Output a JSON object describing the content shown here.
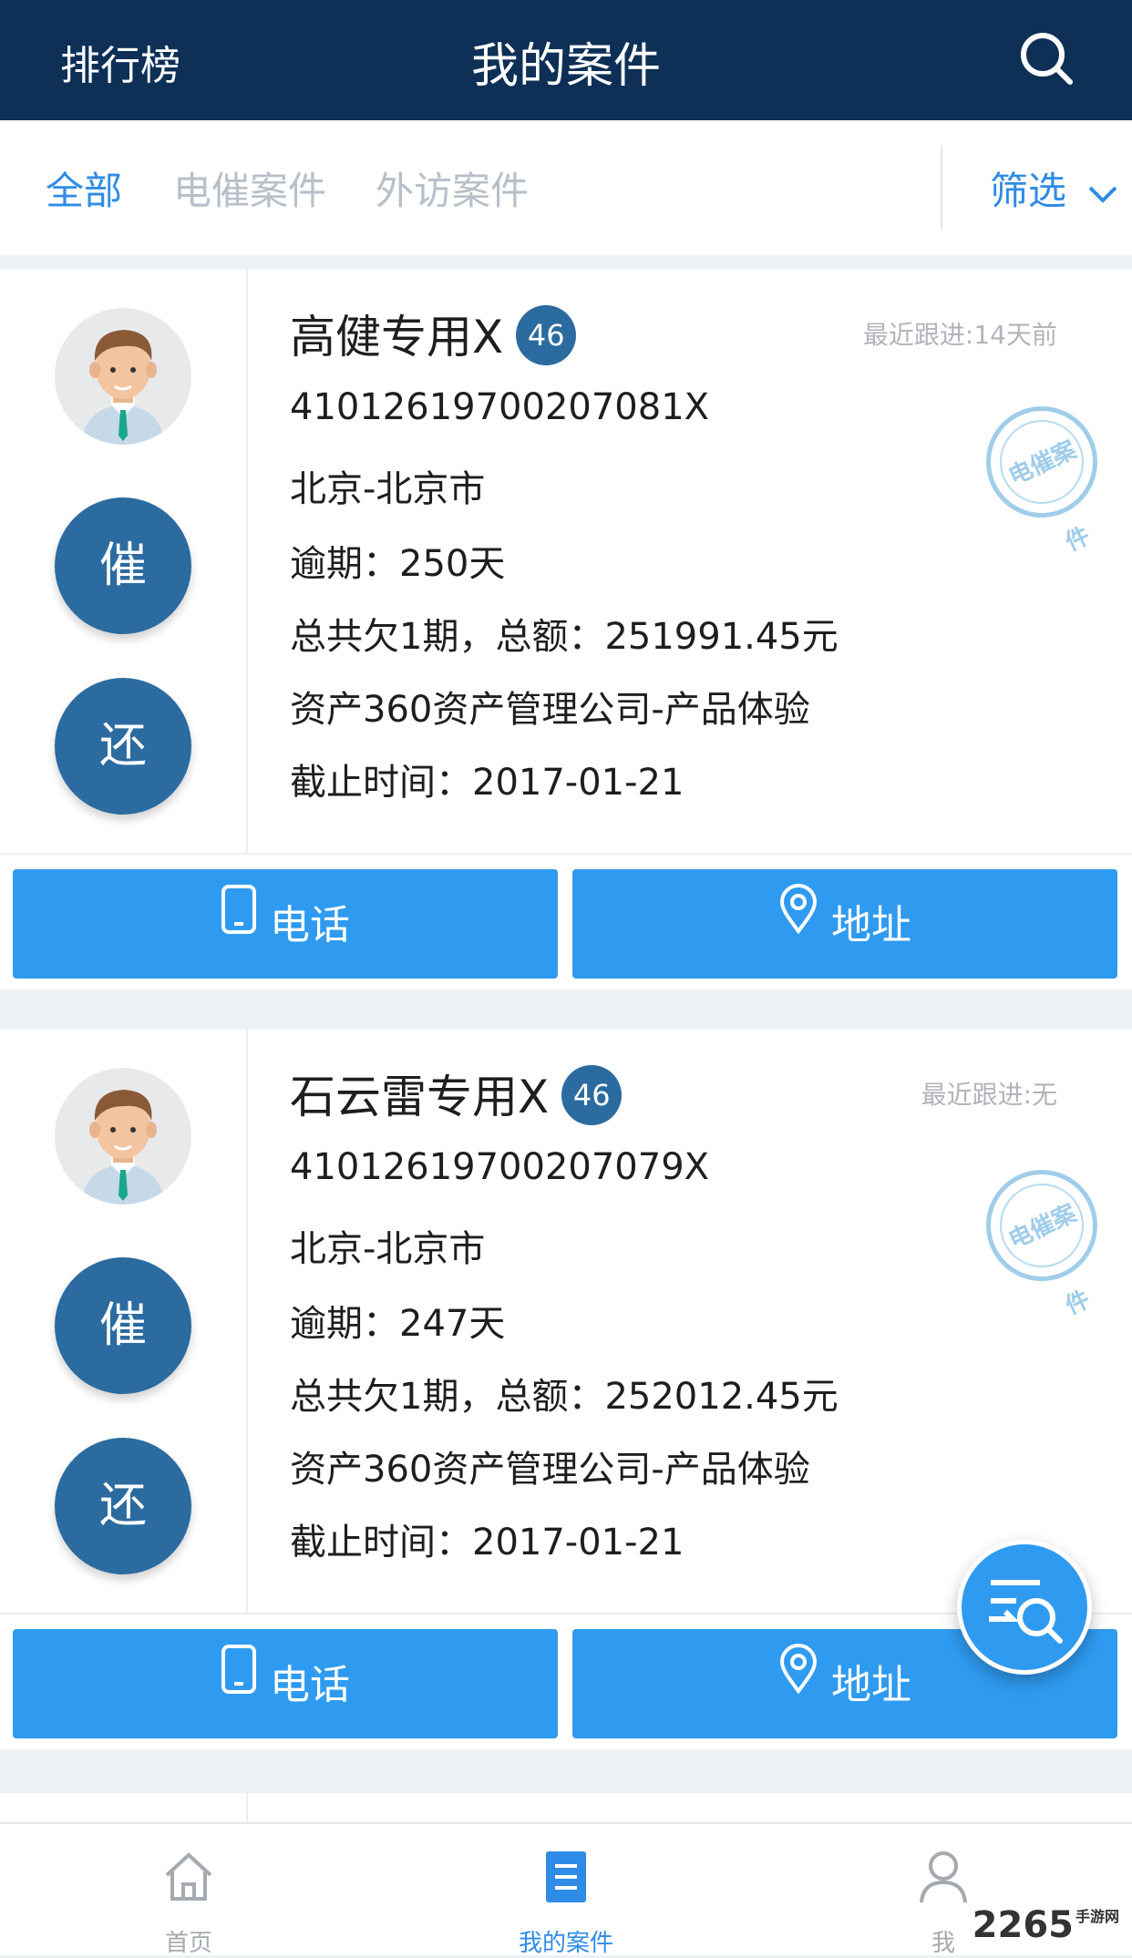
{
  "header": {
    "left_label": "排行榜",
    "title": "我的案件",
    "search_icon": "search-icon"
  },
  "tabs": [
    {
      "label": "全部",
      "active": true
    },
    {
      "label": "电催案件",
      "active": false
    },
    {
      "label": "外访案件",
      "active": false
    }
  ],
  "filter": {
    "label": "筛选",
    "icon": "chevron-down-icon"
  },
  "cards": [
    {
      "name": "高健专用X",
      "badge": "46",
      "last_follow": "最近跟进:14天前",
      "id_number": "41012619700207081X",
      "location": "北京-北京市",
      "overdue": "逾期：250天",
      "debt": "总共欠1期，总额：251991.45元",
      "company": "资产360资产管理公司-产品体验",
      "deadline": "截止时间：2017-01-21",
      "stamp": "电催案件",
      "urge_label": "催",
      "repay_label": "还",
      "phone_label": "电话",
      "address_label": "地址"
    },
    {
      "name": "石云雷专用X",
      "badge": "46",
      "last_follow": "最近跟进:无",
      "id_number": "41012619700207079X",
      "location": "北京-北京市",
      "overdue": "逾期：247天",
      "debt": "总共欠1期，总额：252012.45元",
      "company": "资产360资产管理公司-产品体验",
      "deadline": "截止时间：2017-01-21",
      "stamp": "电催案件",
      "urge_label": "催",
      "repay_label": "还",
      "phone_label": "电话",
      "address_label": "地址"
    }
  ],
  "bottom_nav": [
    {
      "label": "首页",
      "icon": "home-icon",
      "active": false
    },
    {
      "label": "我的案件",
      "icon": "document-list-icon",
      "active": true
    },
    {
      "label": "我",
      "icon": "user-icon",
      "active": false
    }
  ],
  "watermark": {
    "main": "2265",
    "sub": "手游网"
  },
  "colors": {
    "header_bg": "#0e3056",
    "accent": "#2f9bf0",
    "circle_button": "#2b6ba0",
    "tab_active": "#2f8ce6"
  }
}
